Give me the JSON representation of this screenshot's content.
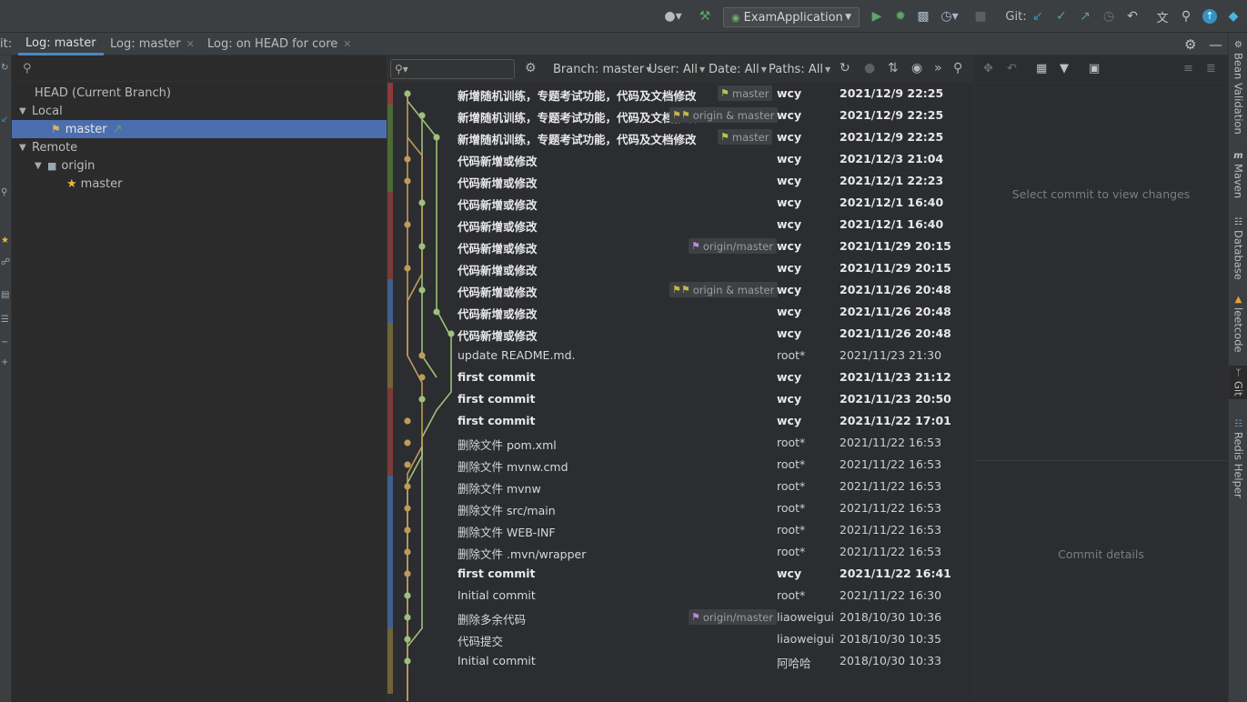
{
  "toolbar": {
    "run_config": "ExamApplication",
    "git_label": "Git:",
    "colors": {
      "run": "#59a869",
      "debug": "#499c54",
      "git_update": "#3592c4",
      "commit": "#59a869",
      "push": "#59a869"
    }
  },
  "tool_window": {
    "prefix": "it:"
  },
  "tabs": [
    {
      "label": "Log: master",
      "active": true,
      "closable": false
    },
    {
      "label": "Log: master",
      "active": false,
      "closable": true
    },
    {
      "label": "Log: on HEAD for core",
      "active": false,
      "closable": true
    }
  ],
  "branches": {
    "head": "HEAD (Current Branch)",
    "local_label": "Local",
    "local_master": "master",
    "remote_label": "Remote",
    "origin_label": "origin",
    "origin_master": "master"
  },
  "log_filters": {
    "branch": "Branch: master",
    "user": "User: All",
    "date": "Date: All",
    "paths": "Paths: All"
  },
  "commits": [
    {
      "message": "新增随机训练，专题考试功能，代码及文档修改",
      "author": "wcy",
      "date": "2021/12/9 22:25",
      "ref": "master",
      "ref_kind": "local",
      "bold": true
    },
    {
      "message": "新增随机训练，专题考试功能，代码及文档修改",
      "author": "wcy",
      "date": "2021/12/9 22:25",
      "ref": "origin & master",
      "ref_kind": "both",
      "bold": true
    },
    {
      "message": "新增随机训练，专题考试功能，代码及文档修改",
      "author": "wcy",
      "date": "2021/12/9 22:25",
      "ref": "master",
      "ref_kind": "local",
      "bold": true
    },
    {
      "message": "代码新增或修改",
      "author": "wcy",
      "date": "2021/12/3 21:04",
      "ref": "",
      "ref_kind": "",
      "bold": true
    },
    {
      "message": "代码新增或修改",
      "author": "wcy",
      "date": "2021/12/1 22:23",
      "ref": "",
      "ref_kind": "",
      "bold": true
    },
    {
      "message": "代码新增或修改",
      "author": "wcy",
      "date": "2021/12/1 16:40",
      "ref": "",
      "ref_kind": "",
      "bold": true
    },
    {
      "message": "代码新增或修改",
      "author": "wcy",
      "date": "2021/12/1 16:40",
      "ref": "",
      "ref_kind": "",
      "bold": true
    },
    {
      "message": "代码新增或修改",
      "author": "wcy",
      "date": "2021/11/29 20:15",
      "ref": "origin/master",
      "ref_kind": "remote",
      "bold": true
    },
    {
      "message": "代码新增或修改",
      "author": "wcy",
      "date": "2021/11/29 20:15",
      "ref": "",
      "ref_kind": "",
      "bold": true
    },
    {
      "message": "代码新增或修改",
      "author": "wcy",
      "date": "2021/11/26 20:48",
      "ref": "origin & master",
      "ref_kind": "both",
      "bold": true
    },
    {
      "message": "代码新增或修改",
      "author": "wcy",
      "date": "2021/11/26 20:48",
      "ref": "",
      "ref_kind": "",
      "bold": true
    },
    {
      "message": "代码新增或修改",
      "author": "wcy",
      "date": "2021/11/26 20:48",
      "ref": "",
      "ref_kind": "",
      "bold": true
    },
    {
      "message": "update README.md.",
      "author": "root*",
      "date": "2021/11/23 21:30",
      "ref": "",
      "ref_kind": "",
      "bold": false
    },
    {
      "message": "first commit",
      "author": "wcy",
      "date": "2021/11/23 21:12",
      "ref": "",
      "ref_kind": "",
      "bold": true
    },
    {
      "message": "first commit",
      "author": "wcy",
      "date": "2021/11/23 20:50",
      "ref": "",
      "ref_kind": "",
      "bold": true
    },
    {
      "message": "first commit",
      "author": "wcy",
      "date": "2021/11/22 17:01",
      "ref": "",
      "ref_kind": "",
      "bold": true
    },
    {
      "message": "删除文件 pom.xml",
      "author": "root*",
      "date": "2021/11/22 16:53",
      "ref": "",
      "ref_kind": "",
      "bold": false
    },
    {
      "message": "删除文件 mvnw.cmd",
      "author": "root*",
      "date": "2021/11/22 16:53",
      "ref": "",
      "ref_kind": "",
      "bold": false
    },
    {
      "message": "删除文件 mvnw",
      "author": "root*",
      "date": "2021/11/22 16:53",
      "ref": "",
      "ref_kind": "",
      "bold": false
    },
    {
      "message": "删除文件 src/main",
      "author": "root*",
      "date": "2021/11/22 16:53",
      "ref": "",
      "ref_kind": "",
      "bold": false
    },
    {
      "message": "删除文件 WEB-INF",
      "author": "root*",
      "date": "2021/11/22 16:53",
      "ref": "",
      "ref_kind": "",
      "bold": false
    },
    {
      "message": "删除文件 .mvn/wrapper",
      "author": "root*",
      "date": "2021/11/22 16:53",
      "ref": "",
      "ref_kind": "",
      "bold": false
    },
    {
      "message": "first commit",
      "author": "wcy",
      "date": "2021/11/22 16:41",
      "ref": "",
      "ref_kind": "",
      "bold": true
    },
    {
      "message": "Initial commit",
      "author": "root*",
      "date": "2021/11/22 16:30",
      "ref": "",
      "ref_kind": "",
      "bold": false
    },
    {
      "message": "删除多余代码",
      "author": "liaoweigui",
      "date": "2018/10/30 10:36",
      "ref": "origin/master",
      "ref_kind": "remote",
      "bold": false
    },
    {
      "message": "代码提交",
      "author": "liaoweigui",
      "date": "2018/10/30 10:35",
      "ref": "",
      "ref_kind": "",
      "bold": false
    },
    {
      "message": "Initial commit",
      "author": "阿哈哈",
      "date": "2018/10/30 10:33",
      "ref": "",
      "ref_kind": "",
      "bold": false
    }
  ],
  "details": {
    "changes_hint": "Select commit to view changes",
    "details_hint": "Commit details"
  },
  "right_tools": [
    {
      "label": "Bean Validation",
      "icon": "bean-validation-icon"
    },
    {
      "label": "Maven",
      "icon": "maven-icon"
    },
    {
      "label": "Database",
      "icon": "database-icon"
    },
    {
      "label": "leetcode",
      "icon": "leetcode-icon"
    },
    {
      "label": "Git",
      "icon": "git-icon"
    },
    {
      "label": "Redis Helper",
      "icon": "redis-icon"
    }
  ],
  "graph_colors": {
    "green": "#9fbf7b",
    "orange": "#c19a5b"
  }
}
